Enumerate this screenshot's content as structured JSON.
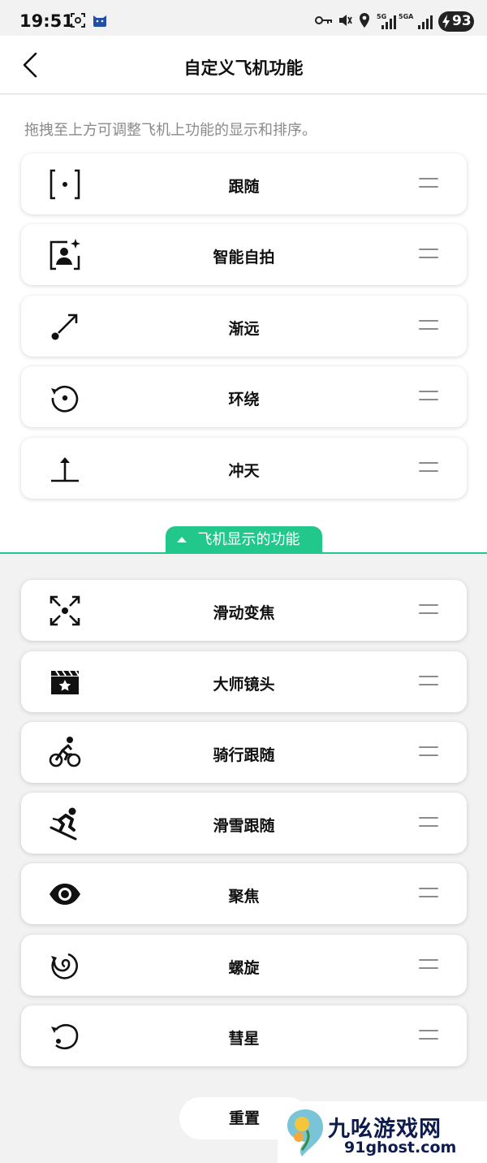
{
  "status_bar": {
    "time": "19:51",
    "signal_left": "5G",
    "signal_right": "5GA",
    "battery": "93"
  },
  "header": {
    "title": "自定义飞机功能"
  },
  "hint": "拖拽至上方可调整飞机上功能的显示和排序。",
  "top_items": [
    {
      "label": "跟随",
      "icon": "follow-frame-icon"
    },
    {
      "label": "智能自拍",
      "icon": "smart-selfie-icon"
    },
    {
      "label": "渐远",
      "icon": "dronie-icon"
    },
    {
      "label": "环绕",
      "icon": "orbit-icon"
    },
    {
      "label": "冲天",
      "icon": "rocket-up-icon"
    }
  ],
  "section_tab": "飞机显示的功能",
  "bottom_items": [
    {
      "label": "滑动变焦",
      "icon": "dolly-zoom-icon"
    },
    {
      "label": "大师镜头",
      "icon": "clapperboard-icon"
    },
    {
      "label": "骑行跟随",
      "icon": "cycling-icon"
    },
    {
      "label": "滑雪跟随",
      "icon": "skiing-icon"
    },
    {
      "label": "聚焦",
      "icon": "eye-icon"
    },
    {
      "label": "螺旋",
      "icon": "spiral-icon"
    },
    {
      "label": "彗星",
      "icon": "comet-icon"
    }
  ],
  "reset_label": "重置",
  "watermark": {
    "title": "九吆游戏网",
    "url": "91ghost.com"
  },
  "colors": {
    "accent": "#22c78b",
    "background": "#f2f2f2",
    "card": "#ffffff"
  }
}
